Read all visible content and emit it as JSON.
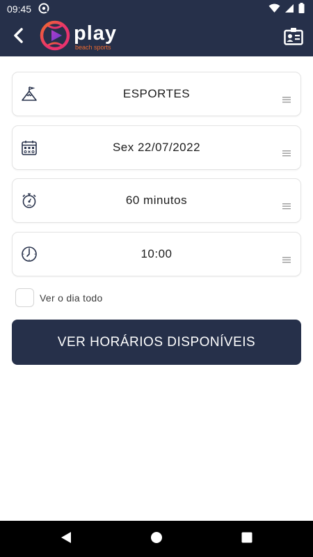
{
  "status_bar": {
    "time": "09:45",
    "icons": [
      "vpn-icon",
      "wifi-icon",
      "signal-icon",
      "battery-icon"
    ]
  },
  "app_bar": {
    "logo_word": "play",
    "logo_sub": "beach sports",
    "colors": {
      "background": "#26304a",
      "accent_orange": "#f06a2e",
      "accent_pink": "#e8336d",
      "accent_purple": "#7a3cc8"
    }
  },
  "form": {
    "sport": {
      "value": "ESPORTES",
      "icon": "mountain-flag-icon"
    },
    "date": {
      "value": "Sex 22/07/2022",
      "icon": "calendar-icon"
    },
    "duration": {
      "value": "60 minutos",
      "icon": "stopwatch-icon"
    },
    "time": {
      "value": "10:00",
      "icon": "clock-icon"
    },
    "all_day": {
      "label": "Ver o dia todo",
      "checked": false
    },
    "submit_label": "VER HORÁRIOS DISPONÍVEIS"
  },
  "nav_bar": {
    "icons": [
      "back-triangle-icon",
      "home-circle-icon",
      "recents-square-icon"
    ]
  }
}
